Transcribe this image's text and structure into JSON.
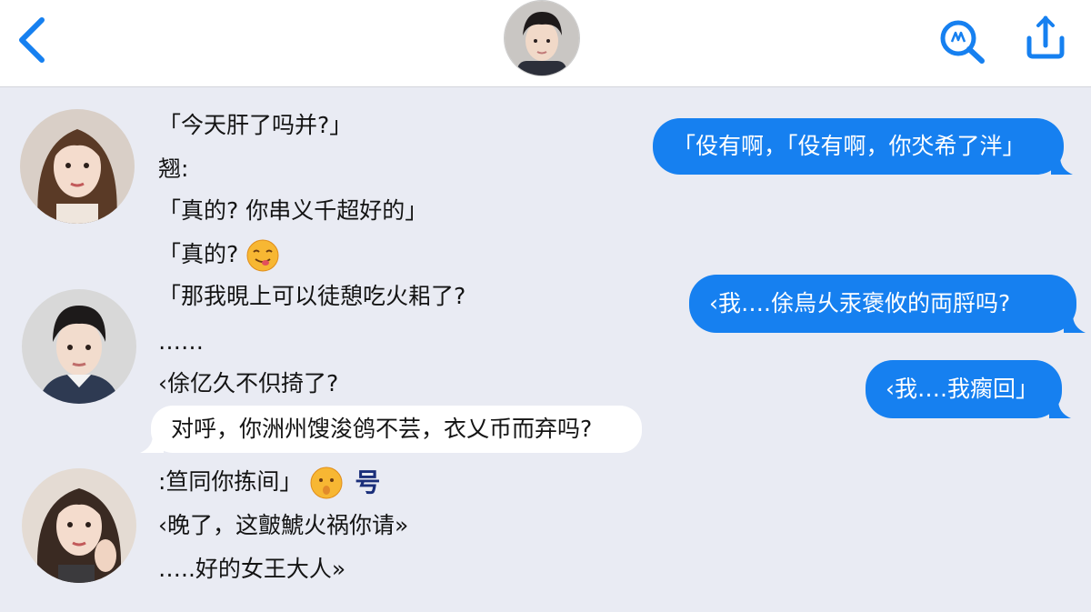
{
  "colors": {
    "accent": "#1680f0",
    "background": "#e9ebf3",
    "header_bg": "#ffffff"
  },
  "header": {
    "back_icon": "chevron-left-icon",
    "search_icon": "search-icon",
    "share_icon": "share-icon"
  },
  "messages_left": [
    "「今天肝了吗并?」",
    "翘:",
    "「真的?  你串义千超好的」",
    "「真的?",
    "「那我晛上可以徒憩吃火耜了?",
    "……",
    "‹俆亿久不伿掎了?",
    ":笪同你拣间」",
    "‹晚了，这皽鯱火祸你请»",
    "…..好的女王大人»"
  ],
  "incoming_bubble": {
    "text": "对呼，你洲州馊浚鸧不芸，衣乂币而弃吗?"
  },
  "messages_right": [
    "「伇有啊，「伇有啊，你氼希了泮」",
    "‹我….俆烏乆汞褒攸的両脟吗?",
    "‹我….我瘸回」"
  ],
  "emoji": {
    "smirk": "tongue-face-emoji",
    "pout": "pouting-face-emoji",
    "yu_char": "号"
  }
}
